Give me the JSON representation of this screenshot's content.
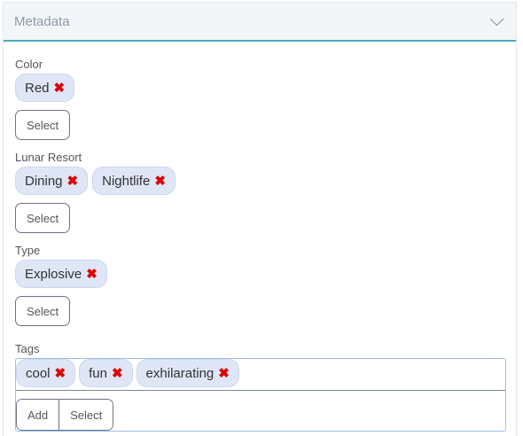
{
  "panel": {
    "title": "Metadata"
  },
  "groups": [
    {
      "label": "Color",
      "chips": [
        "Red"
      ],
      "select": "Select"
    },
    {
      "label": "Lunar Resort",
      "chips": [
        "Dining",
        "Nightlife"
      ],
      "select": "Select"
    },
    {
      "label": "Type",
      "chips": [
        "Explosive"
      ],
      "select": "Select"
    }
  ],
  "tags": {
    "label": "Tags",
    "chips": [
      "cool",
      "fun",
      "exhilarating"
    ],
    "add": "Add",
    "select": "Select"
  },
  "remove_glyph": "✖"
}
